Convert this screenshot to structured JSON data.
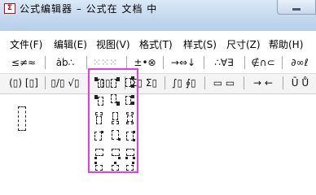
{
  "window": {
    "title": "公式编辑器 – 公式在 文档 中",
    "app_icon": "formula-editor-icon"
  },
  "menu": [
    "文件(F)",
    "编辑(E)",
    "视图(V)",
    "格式(T)",
    "样式(S)",
    "尺寸(Z)",
    "帮助(H)"
  ],
  "palette_row1": [
    "≤≠≈",
    "ȧb∴",
    "⁙⁙⁙",
    "±•⊗",
    "→⇔↓",
    "∴∀∃",
    "∉∩⊂",
    "∂∞ℓ"
  ],
  "palette_row2": [
    "(▯) [▯]",
    "▯/▯ √▯",
    "▯▯",
    "Σ▯ Σ▯",
    "∫▯ ∮▯",
    "▭ ▭",
    "→ ←",
    "Ū Ů"
  ],
  "colors": {
    "highlight": "#e23ee0"
  }
}
